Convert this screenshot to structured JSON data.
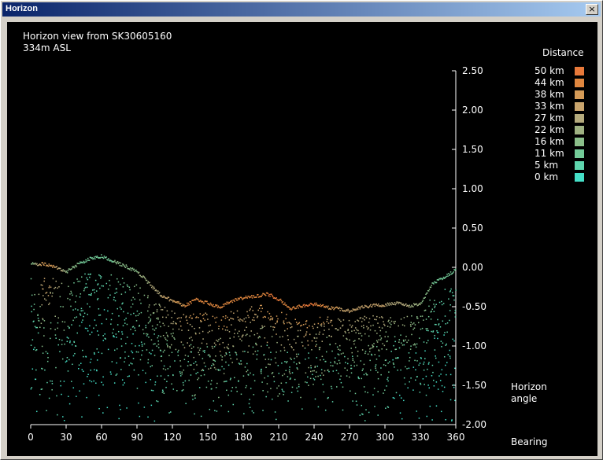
{
  "window": {
    "title": "Horizon",
    "close_label": "×"
  },
  "chart_data": {
    "type": "scatter",
    "title": "Horizon view from SK30605160",
    "subtitle": "334m ASL",
    "xlabel": "Bearing",
    "ylabel": [
      "Horizon",
      "angle"
    ],
    "xlim": [
      0,
      360
    ],
    "ylim": [
      -2.0,
      2.5
    ],
    "x_ticks": [
      0,
      30,
      60,
      90,
      120,
      150,
      180,
      210,
      240,
      270,
      300,
      330,
      360
    ],
    "y_ticks": [
      2.5,
      2.0,
      1.5,
      1.0,
      0.5,
      0.0,
      -0.5,
      -1.0,
      -1.5,
      -2.0
    ],
    "y_tick_labels": [
      "2.50",
      "2.00",
      "1.50",
      "1.00",
      "0.50",
      "0.00",
      "-0.50",
      "-1.00",
      "-1.50",
      "-2.00"
    ],
    "grid": false,
    "legend": {
      "title": "Distance",
      "position": "top-right",
      "items": [
        {
          "label": "50 km",
          "color": "#e8793a"
        },
        {
          "label": "44 km",
          "color": "#e0873f"
        },
        {
          "label": "38 km",
          "color": "#d59b57"
        },
        {
          "label": "33 km",
          "color": "#c9a56d"
        },
        {
          "label": "27 km",
          "color": "#b5ab7d"
        },
        {
          "label": "22 km",
          "color": "#9fb282"
        },
        {
          "label": "16 km",
          "color": "#8bbf8a"
        },
        {
          "label": "11 km",
          "color": "#73cb98"
        },
        {
          "label": "5 km",
          "color": "#5fd6ae"
        },
        {
          "label": "0 km",
          "color": "#45e0c8"
        }
      ]
    },
    "horizon_profile": {
      "bearings": [
        0,
        10,
        20,
        30,
        40,
        50,
        60,
        70,
        80,
        90,
        100,
        110,
        120,
        130,
        140,
        150,
        160,
        170,
        180,
        190,
        200,
        210,
        220,
        230,
        240,
        250,
        260,
        270,
        280,
        290,
        300,
        310,
        320,
        330,
        340,
        350,
        360
      ],
      "angles": [
        0.05,
        0.05,
        0.02,
        -0.05,
        0.05,
        0.12,
        0.15,
        0.08,
        0.02,
        -0.05,
        -0.2,
        -0.35,
        -0.42,
        -0.48,
        -0.4,
        -0.45,
        -0.5,
        -0.42,
        -0.38,
        -0.36,
        -0.33,
        -0.4,
        -0.52,
        -0.48,
        -0.46,
        -0.5,
        -0.52,
        -0.55,
        -0.5,
        -0.48,
        -0.47,
        -0.45,
        -0.48,
        -0.46,
        -0.2,
        -0.12,
        -0.02
      ],
      "distances_km": [
        16,
        44,
        38,
        22,
        16,
        11,
        11,
        16,
        16,
        22,
        27,
        33,
        38,
        44,
        50,
        44,
        50,
        44,
        44,
        44,
        50,
        50,
        44,
        50,
        50,
        44,
        38,
        33,
        33,
        38,
        33,
        27,
        27,
        22,
        16,
        11,
        11
      ]
    }
  }
}
